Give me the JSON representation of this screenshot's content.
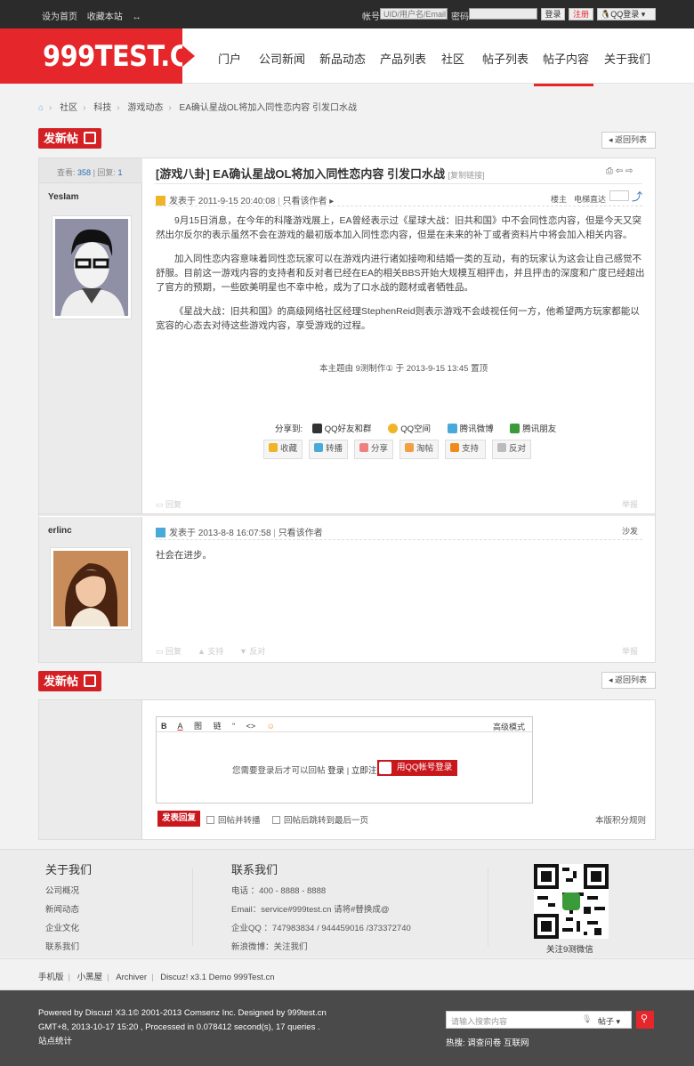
{
  "topbar": {
    "set_home": "设为首页",
    "bookmark": "收藏本站",
    "account_label": "帐号",
    "account_placeholder": "UID/用户名/Email",
    "password_label": "密码",
    "login": "登录",
    "register": "注册",
    "qq_login": "QQ登录"
  },
  "header": {
    "logo": "999TEST.CN",
    "nav": [
      "门户",
      "公司新闻",
      "新品动态",
      "产品列表",
      "社区",
      "帖子列表",
      "帖子内容",
      "关于我们"
    ],
    "active": "帖子内容"
  },
  "breadcrumb": [
    "社区",
    "科技",
    "游戏动态",
    "EA确认星战OL将加入同性恋内容 引发口水战"
  ],
  "buttons": {
    "new_post": "发新帖",
    "back_list": "返回列表"
  },
  "thread": {
    "view_label": "查看:",
    "views": "358",
    "reply_label": "回复:",
    "replies": "1",
    "category": "[游戏八卦]",
    "title": "EA确认星战OL将加入同性恋内容 引发口水战",
    "copy_link": "[复制链接]"
  },
  "posts": [
    {
      "author": "YesIam",
      "time": "发表于 2011-9-15 20:40:08",
      "only_author": "只看该作者",
      "floor": "楼主",
      "jump": "电梯直达",
      "paragraphs": [
        "9月15日消息，在今年的科隆游戏展上，EA曾经表示过《星球大战：旧共和国》中不会同性恋内容，但是今天又突然出尔反尔的表示虽然不会在游戏的最初版本加入同性恋内容，但是在未来的补丁或者资料片中将会加入相关内容。",
        "加入同性恋内容意味着同性恋玩家可以在游戏内进行诸如接吻和结婚一类的互动，有的玩家认为这会让自己感觉不舒服。目前这一游戏内容的支持者和反对者已经在EA的相关BBS开始大规模互相抨击，并且抨击的深度和广度已经超出了官方的预期，一些欧美明星也不幸中枪，成为了口水战的题材或者牺牲品。",
        "《星战大战：旧共和国》的高级网络社区经理StephenReid则表示游戏不会歧视任何一方，他希望两方玩家都能以宽容的心态去对待这些游戏内容，享受游戏的过程。"
      ],
      "sticky_note": "本主题由 9测制作① 于 2013-9-15 13:45 置顶",
      "share_label": "分享到:",
      "share": [
        "QQ好友和群",
        "QQ空间",
        "腾讯微博",
        "腾讯朋友"
      ],
      "actions": [
        "收藏",
        "转播",
        "分享",
        "淘帖",
        "支持",
        "反对"
      ],
      "reply": "回复",
      "report": "举报"
    },
    {
      "author": "erlinc",
      "time": "发表于 2013-8-8 16:07:58",
      "only_author": "只看该作者",
      "floor": "沙发",
      "content": "社会在进步。",
      "actions": [
        "回复",
        "支持",
        "反对"
      ],
      "report": "举报"
    }
  ],
  "reply_box": {
    "toolbar": [
      "B",
      "A",
      "图",
      "链",
      "“",
      "<>",
      "☺"
    ],
    "mode": "高级模式",
    "need_login": "您需要登录后才可以回帖",
    "login": "登录",
    "register": "立即注册",
    "qq_login": "用QQ帐号登录",
    "submit": "发表回复",
    "opt1": "回帖并转播",
    "opt2": "回帖后跳转到最后一页",
    "rules": "本版积分规则"
  },
  "footer": {
    "about_title": "关于我们",
    "about_links": [
      "公司概况",
      "新闻动态",
      "企业文化",
      "联系我们"
    ],
    "contact_title": "联系我们",
    "contact": [
      "电话 ：400 - 8888 - 8888",
      "Email：service#999test.cn 请将#替换成@",
      "企业QQ ：747983834 / 944459016 /373372740",
      "新浪微博：关注我们"
    ],
    "qr_caption": "关注9测微信",
    "links": [
      "手机版",
      "小黑屋",
      "Archiver",
      "Discuz! x3.1 Demo 999Test.cn"
    ],
    "powered": "Powered by Discuz! X3.1© 2001-2013 Comsenz Inc. Designed by 999test.cn",
    "gmt": "GMT+8, 2013-10-17 15:20 , Processed in 0.078412 second(s), 17 queries .",
    "stats": "站点统计",
    "search_placeholder": "请输入搜索内容",
    "search_type": "帖子",
    "hot_label": "热搜:",
    "hot": [
      "调查问卷",
      "互联网"
    ]
  },
  "colors": {
    "brand": "#e5262a",
    "link": "#2a6cb0"
  }
}
